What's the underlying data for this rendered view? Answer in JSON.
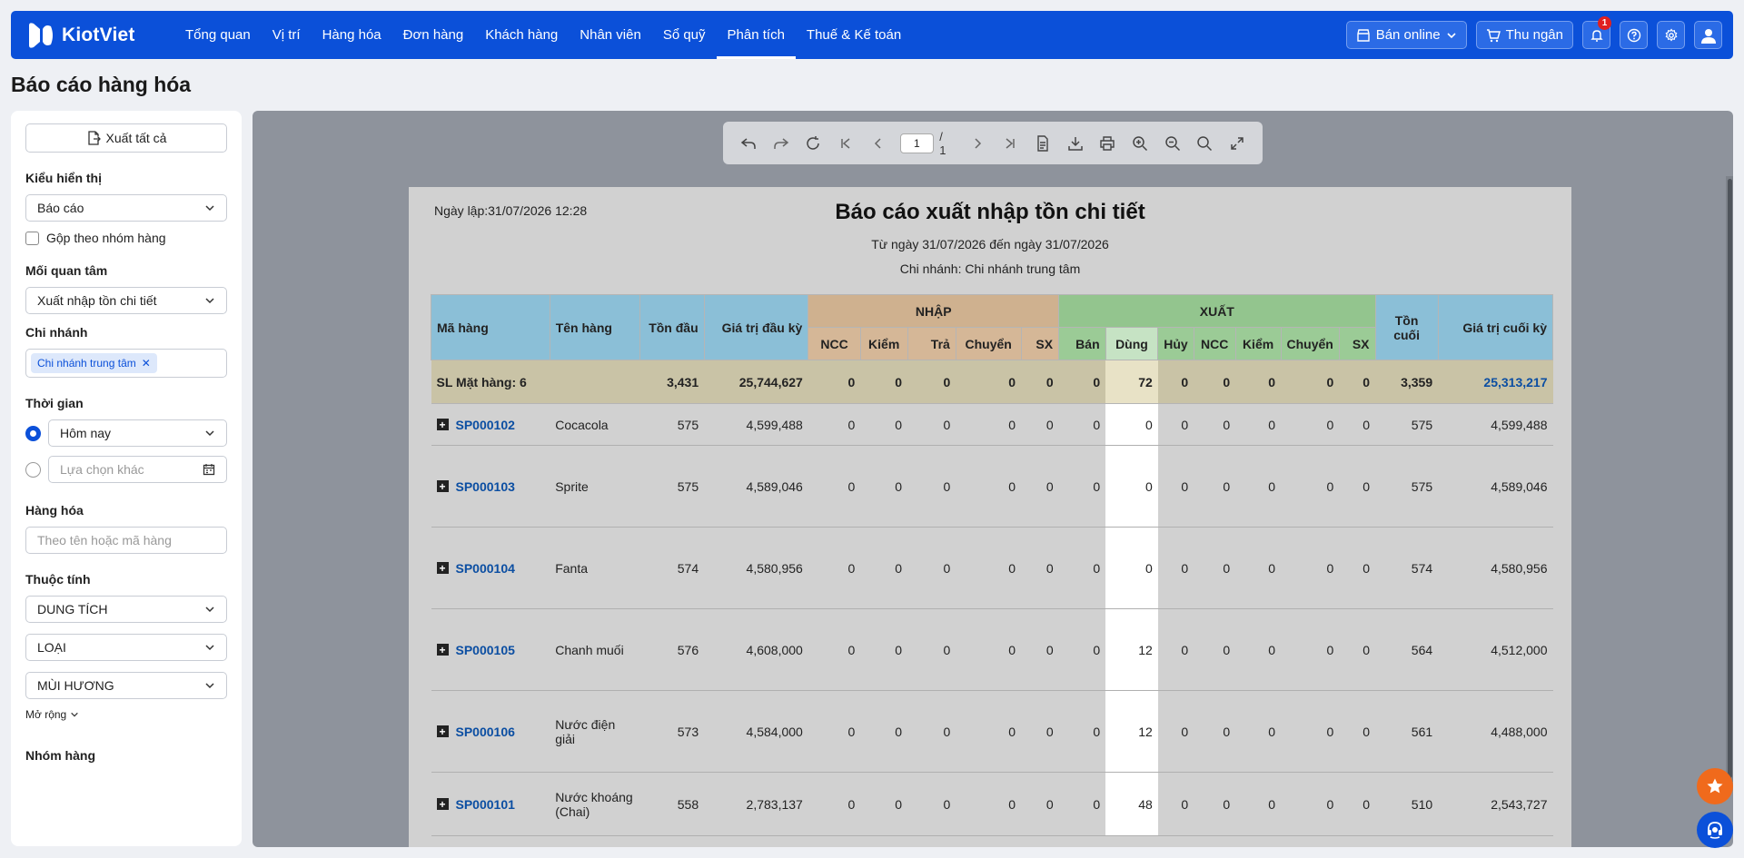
{
  "app": {
    "logo_text": "KiotViet"
  },
  "nav": {
    "items": [
      "Tổng quan",
      "Vị trí",
      "Hàng hóa",
      "Đơn hàng",
      "Khách hàng",
      "Nhân viên",
      "Sổ quỹ",
      "Phân tích",
      "Thuế & Kế toán"
    ],
    "active": "Phân tích"
  },
  "topbar": {
    "sell_online": "Bán online",
    "cashier": "Thu ngân",
    "notification_count": "1"
  },
  "page": {
    "title": "Báo cáo hàng hóa"
  },
  "sidebar": {
    "export_all": "Xuất tất cả",
    "display_label": "Kiểu hiển thị",
    "display_value": "Báo cáo",
    "group_checkbox": "Gộp theo nhóm hàng",
    "concern_label": "Mối quan tâm",
    "concern_value": "Xuất nhập tồn chi tiết",
    "branch_label": "Chi nhánh",
    "branch_tag": "Chi nhánh trung tâm",
    "time_label": "Thời gian",
    "time_today": "Hôm nay",
    "time_other_placeholder": "Lựa chọn khác",
    "goods_label": "Hàng hóa",
    "goods_placeholder": "Theo tên hoặc mã hàng",
    "attr_label": "Thuộc tính",
    "attr_1": "DUNG TÍCH",
    "attr_2": "LOẠI",
    "attr_3": "MÙI HƯƠNG",
    "expand": "Mở rộng",
    "group_label": "Nhóm hàng"
  },
  "viewer": {
    "page_current": "1",
    "page_total": "/ 1"
  },
  "report": {
    "created": "Ngày lập:31/07/2026 12:28",
    "title": "Báo cáo xuất nhập tồn chi tiết",
    "range": "Từ ngày 31/07/2026 đến ngày 31/07/2026",
    "branch": "Chi nhánh: Chi nhánh trung tâm",
    "headers": {
      "code": "Mã hàng",
      "name": "Tên hàng",
      "open_qty": "Tồn đầu",
      "open_value": "Giá trị đầu kỳ",
      "nhap": "NHẬP",
      "xuat": "XUẤT",
      "close_qty": "Tồn cuối",
      "close_value": "Giá trị cuối kỳ",
      "nhap_cols": [
        "NCC",
        "Kiểm",
        "Trả",
        "Chuyển",
        "SX"
      ],
      "xuat_cols": [
        "Bán",
        "Dùng",
        "Hủy",
        "NCC",
        "Kiểm",
        "Chuyển",
        "SX"
      ]
    },
    "summary": {
      "label": "SL Mặt hàng: 6",
      "open_qty": "3,431",
      "open_value": "25,744,627",
      "nhap": [
        "0",
        "0",
        "0",
        "0",
        "0"
      ],
      "xuat": [
        "0",
        "72",
        "0",
        "0",
        "0",
        "0",
        "0"
      ],
      "close_qty": "3,359",
      "close_value": "25,313,217"
    },
    "rows": [
      {
        "code": "SP000102",
        "name": "Cocacola",
        "open_qty": "575",
        "open_value": "4,599,488",
        "nhap": [
          "0",
          "0",
          "0",
          "0",
          "0"
        ],
        "xuat": [
          "0",
          "0",
          "0",
          "0",
          "0",
          "0",
          "0"
        ],
        "close_qty": "575",
        "close_value": "4,599,488"
      },
      {
        "code": "SP000103",
        "name": "Sprite",
        "open_qty": "575",
        "open_value": "4,589,046",
        "nhap": [
          "0",
          "0",
          "0",
          "0",
          "0"
        ],
        "xuat": [
          "0",
          "0",
          "0",
          "0",
          "0",
          "0",
          "0"
        ],
        "close_qty": "575",
        "close_value": "4,589,046"
      },
      {
        "code": "SP000104",
        "name": "Fanta",
        "open_qty": "574",
        "open_value": "4,580,956",
        "nhap": [
          "0",
          "0",
          "0",
          "0",
          "0"
        ],
        "xuat": [
          "0",
          "0",
          "0",
          "0",
          "0",
          "0",
          "0"
        ],
        "close_qty": "574",
        "close_value": "4,580,956"
      },
      {
        "code": "SP000105",
        "name": "Chanh muối",
        "open_qty": "576",
        "open_value": "4,608,000",
        "nhap": [
          "0",
          "0",
          "0",
          "0",
          "0"
        ],
        "xuat": [
          "0",
          "12",
          "0",
          "0",
          "0",
          "0",
          "0"
        ],
        "close_qty": "564",
        "close_value": "4,512,000"
      },
      {
        "code": "SP000106",
        "name": "Nước điện giải",
        "open_qty": "573",
        "open_value": "4,584,000",
        "nhap": [
          "0",
          "0",
          "0",
          "0",
          "0"
        ],
        "xuat": [
          "0",
          "12",
          "0",
          "0",
          "0",
          "0",
          "0"
        ],
        "close_qty": "561",
        "close_value": "4,488,000"
      },
      {
        "code": "SP000101",
        "name": "Nước khoáng (Chai)",
        "open_qty": "558",
        "open_value": "2,783,137",
        "nhap": [
          "0",
          "0",
          "0",
          "0",
          "0"
        ],
        "xuat": [
          "0",
          "48",
          "0",
          "0",
          "0",
          "0",
          "0"
        ],
        "close_qty": "510",
        "close_value": "2,543,727"
      }
    ]
  },
  "colors": {
    "brand": "#0b50d9",
    "accent_orange": "#f06a1c",
    "link_blue": "#0b4ea2"
  }
}
